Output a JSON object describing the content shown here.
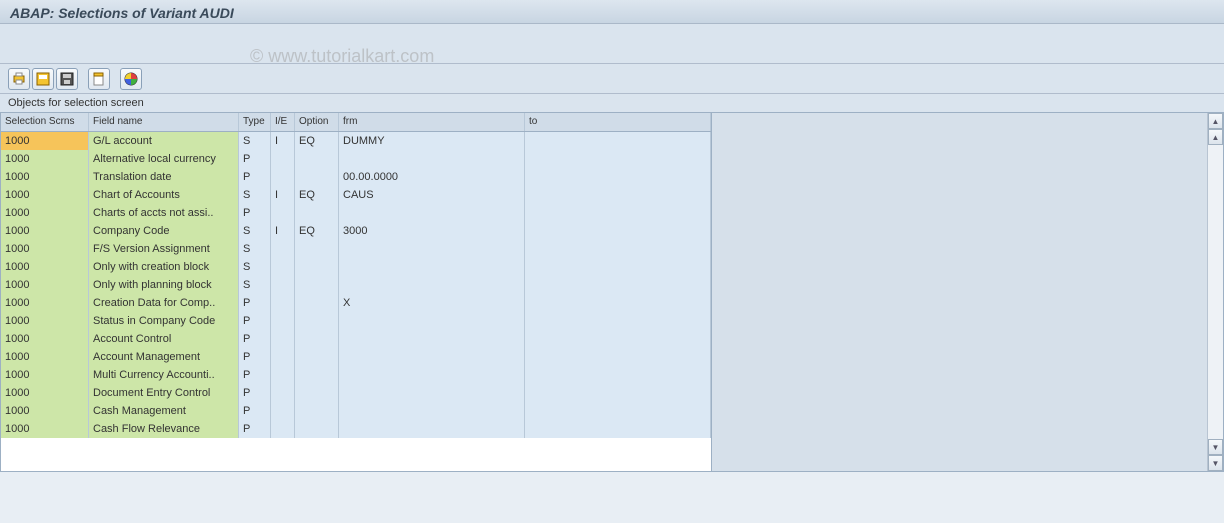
{
  "title": "ABAP: Selections of Variant AUDI",
  "watermark": "© www.tutorialkart.com",
  "toolbar": {
    "btn1": "variant-attributes",
    "btn2": "save-as-variant",
    "btn3": "save",
    "btn4": "display",
    "btn5": "color-legend"
  },
  "section_label": "Objects for selection screen",
  "columns": {
    "scrn": "Selection Scrns",
    "field": "Field name",
    "type": "Type",
    "ie": "I/E",
    "option": "Option",
    "frm": "frm",
    "to": "to"
  },
  "rows": [
    {
      "scrn": "1000",
      "field": "G/L account",
      "type": "S",
      "ie": "I",
      "option": "EQ",
      "frm": "DUMMY",
      "to": "",
      "sel": true
    },
    {
      "scrn": "1000",
      "field": "Alternative local currency",
      "type": "P",
      "ie": "",
      "option": "",
      "frm": "",
      "to": ""
    },
    {
      "scrn": "1000",
      "field": "Translation date",
      "type": "P",
      "ie": "",
      "option": "",
      "frm": "00.00.0000",
      "to": ""
    },
    {
      "scrn": "1000",
      "field": "Chart of Accounts",
      "type": "S",
      "ie": "I",
      "option": "EQ",
      "frm": "CAUS",
      "to": ""
    },
    {
      "scrn": "1000",
      "field": "Charts of accts not assi..",
      "type": "P",
      "ie": "",
      "option": "",
      "frm": "",
      "to": ""
    },
    {
      "scrn": "1000",
      "field": "Company Code",
      "type": "S",
      "ie": "I",
      "option": "EQ",
      "frm": "3000",
      "to": ""
    },
    {
      "scrn": "1000",
      "field": "F/S Version Assignment",
      "type": "S",
      "ie": "",
      "option": "",
      "frm": "",
      "to": ""
    },
    {
      "scrn": "1000",
      "field": "Only with creation block",
      "type": "S",
      "ie": "",
      "option": "",
      "frm": "",
      "to": ""
    },
    {
      "scrn": "1000",
      "field": "Only with planning block",
      "type": "S",
      "ie": "",
      "option": "",
      "frm": "",
      "to": ""
    },
    {
      "scrn": "1000",
      "field": "Creation Data for Comp..",
      "type": "P",
      "ie": "",
      "option": "",
      "frm": "X",
      "to": ""
    },
    {
      "scrn": "1000",
      "field": "Status in Company Code",
      "type": "P",
      "ie": "",
      "option": "",
      "frm": "",
      "to": ""
    },
    {
      "scrn": "1000",
      "field": "Account Control",
      "type": "P",
      "ie": "",
      "option": "",
      "frm": "",
      "to": ""
    },
    {
      "scrn": "1000",
      "field": "Account Management",
      "type": "P",
      "ie": "",
      "option": "",
      "frm": "",
      "to": ""
    },
    {
      "scrn": "1000",
      "field": "Multi Currency Accounti..",
      "type": "P",
      "ie": "",
      "option": "",
      "frm": "",
      "to": ""
    },
    {
      "scrn": "1000",
      "field": "Document Entry Control",
      "type": "P",
      "ie": "",
      "option": "",
      "frm": "",
      "to": ""
    },
    {
      "scrn": "1000",
      "field": "Cash Management",
      "type": "P",
      "ie": "",
      "option": "",
      "frm": "",
      "to": ""
    },
    {
      "scrn": "1000",
      "field": "Cash Flow Relevance",
      "type": "P",
      "ie": "",
      "option": "",
      "frm": "",
      "to": ""
    }
  ]
}
